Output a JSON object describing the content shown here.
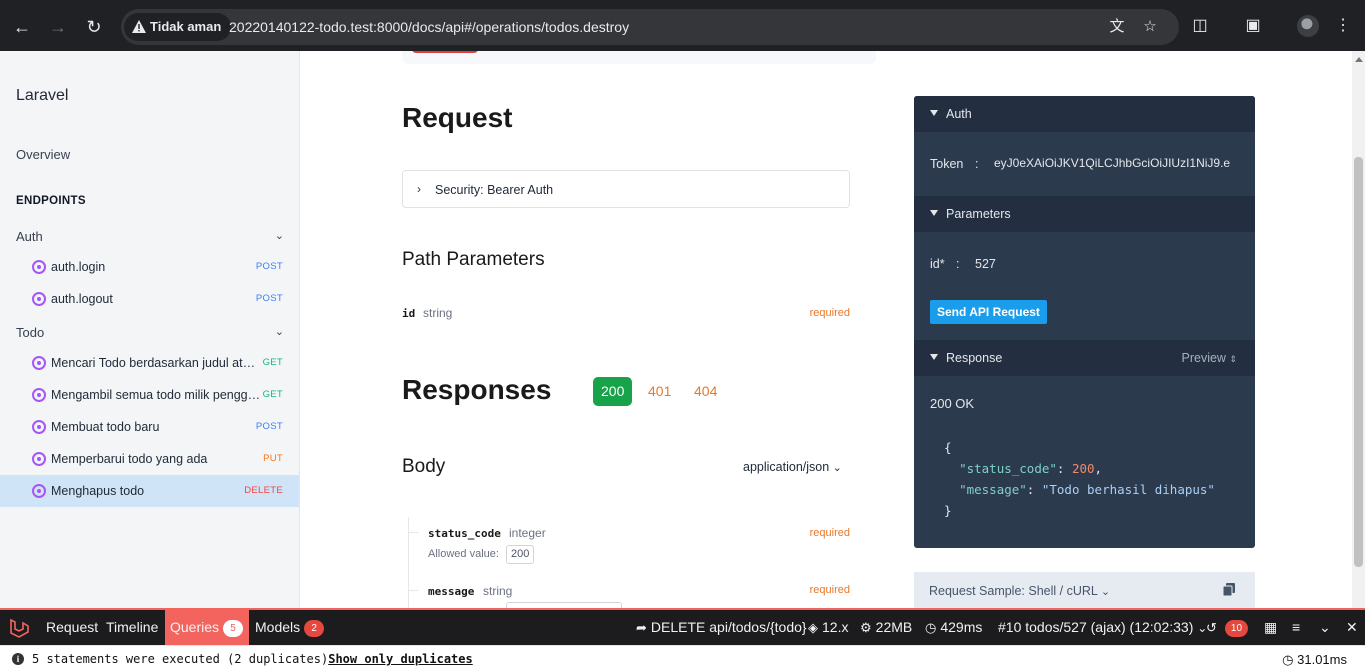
{
  "browser": {
    "security_label": "Tidak aman",
    "url": "20220140122-todo.test:8000/docs/api#/operations/todos.destroy"
  },
  "sidebar": {
    "brand": "Laravel",
    "overview": "Overview",
    "section": "ENDPOINTS",
    "groups": [
      {
        "label": "Auth",
        "items": [
          {
            "label": "auth.login",
            "method": "POST"
          },
          {
            "label": "auth.logout",
            "method": "POST"
          }
        ]
      },
      {
        "label": "Todo",
        "items": [
          {
            "label": "Mencari Todo berdasarkan judul atau…",
            "method": "GET"
          },
          {
            "label": "Mengambil semua todo milik penggu…",
            "method": "GET"
          },
          {
            "label": "Membuat todo baru",
            "method": "POST"
          },
          {
            "label": "Memperbarui todo yang ada",
            "method": "PUT"
          },
          {
            "label": "Menghapus todo",
            "method": "DELETE",
            "active": true
          }
        ]
      }
    ]
  },
  "main": {
    "request_title": "Request",
    "security": "Security: Bearer Auth",
    "path_params_title": "Path Parameters",
    "path_param": {
      "name": "id",
      "type": "string",
      "required": "required"
    },
    "responses_title": "Responses",
    "response_codes": [
      "200",
      "401",
      "404"
    ],
    "body_title": "Body",
    "content_type": "application/json",
    "fields": [
      {
        "name": "status_code",
        "type": "integer",
        "required": "required",
        "allowed_label": "Allowed value:",
        "allowed_value": "200"
      },
      {
        "name": "message",
        "type": "string",
        "required": "required"
      }
    ]
  },
  "panel": {
    "auth_title": "Auth",
    "token_label": "Token",
    "token_sep": ":",
    "token_value": "eyJ0eXAiOiJKV1QiLCJhbGciOiJIUzI1NiJ9.e",
    "params_title": "Parameters",
    "id_label": "id*",
    "id_sep": ":",
    "id_value": "527",
    "send_button": "Send API Request",
    "response_title": "Response",
    "preview_label": "Preview",
    "status": "200 OK",
    "json": {
      "open": "{",
      "k1": "\"status_code\"",
      "v1": "200",
      "k2": "\"message\"",
      "v2": "\"Todo berhasil dihapus\"",
      "close": "}"
    },
    "sample_label": "Request Sample: Shell / cURL"
  },
  "debugbar": {
    "tabs": [
      {
        "label": "Request"
      },
      {
        "label": "Timeline"
      },
      {
        "label": "Queries",
        "badge": "5"
      },
      {
        "label": "Models",
        "badge": "2"
      }
    ],
    "route": "DELETE api/todos/{todo}",
    "laravel_version": "12.x",
    "memory": "22MB",
    "duration": "429ms",
    "request_select": "#10 todos/527 (ajax) (12:02:33)",
    "history_count": "10",
    "status_message": "5 statements were executed (2 duplicates)",
    "status_link": "Show only duplicates",
    "status_time": "31.01ms"
  },
  "colors": {
    "accent": "#f4645f",
    "panel": "#2c3a4e",
    "success": "#16a34a",
    "required": "#e8782a"
  }
}
